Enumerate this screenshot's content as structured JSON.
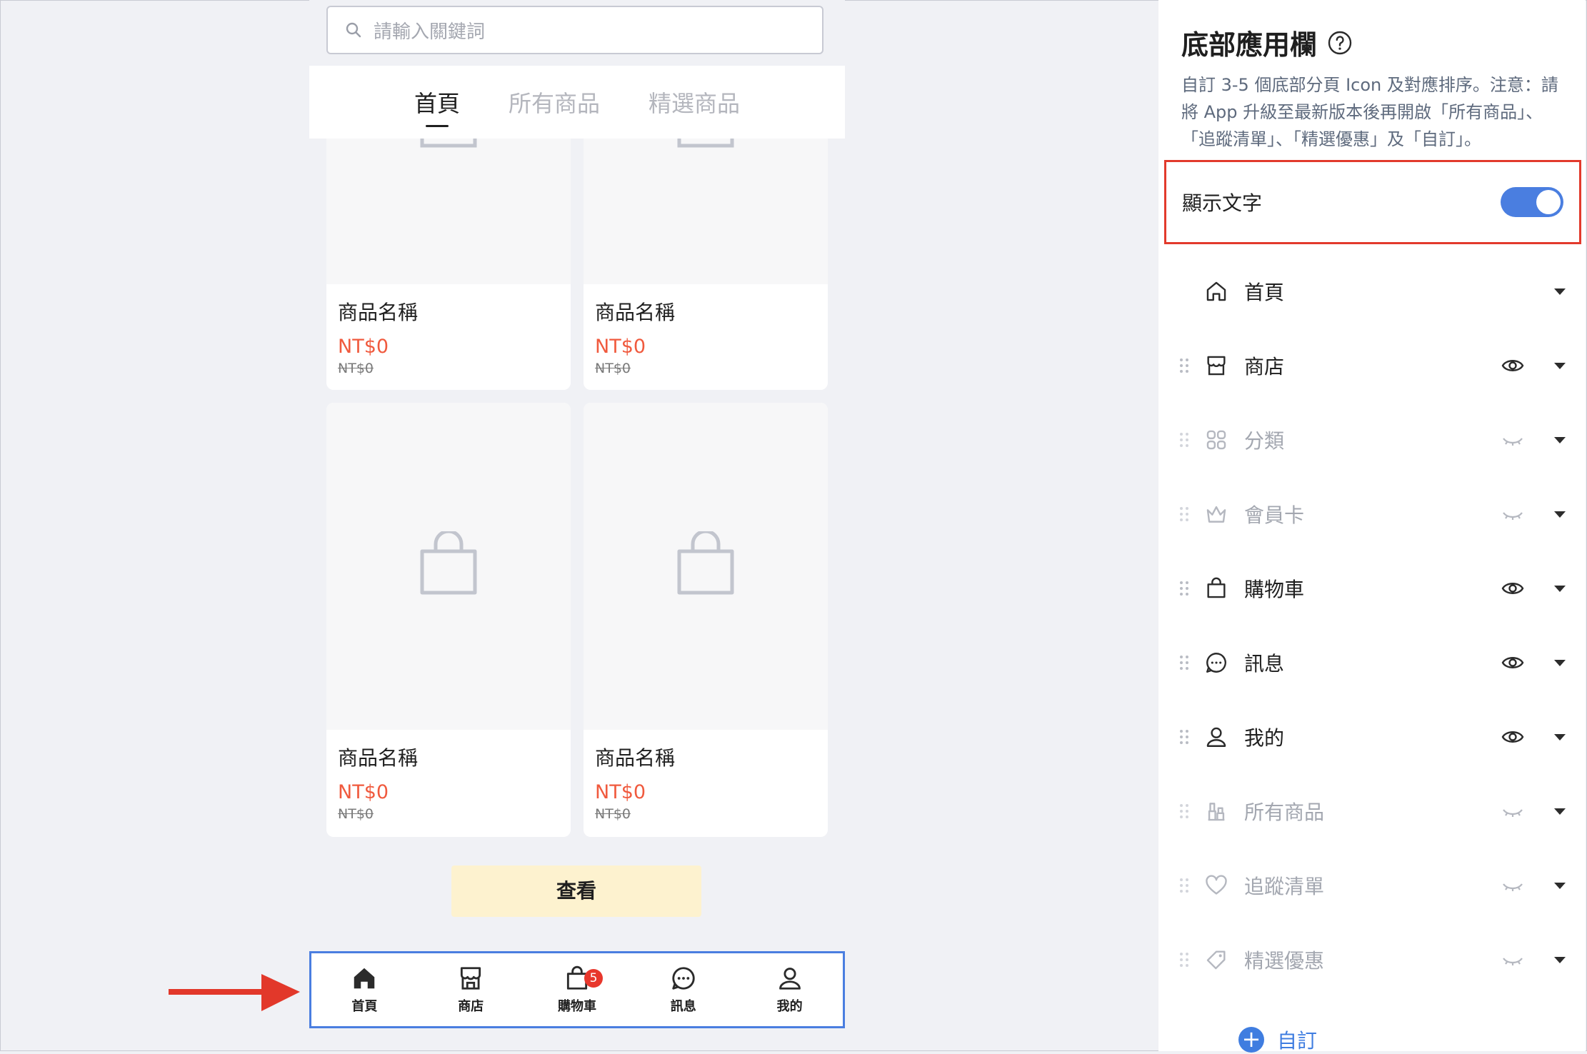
{
  "phone": {
    "search_placeholder": "請輸入關鍵詞",
    "tabs": [
      {
        "label": "首頁",
        "active": true
      },
      {
        "label": "所有商品",
        "active": false
      },
      {
        "label": "精選商品",
        "active": false
      }
    ],
    "products": [
      {
        "name": "商品名稱",
        "price": "NT$0",
        "original_price": "NT$0"
      },
      {
        "name": "商品名稱",
        "price": "NT$0",
        "original_price": "NT$0"
      },
      {
        "name": "商品名稱",
        "price": "NT$0",
        "original_price": "NT$0"
      },
      {
        "name": "商品名稱",
        "price": "NT$0",
        "original_price": "NT$0"
      }
    ],
    "view_button": "查看",
    "bottom_nav": [
      {
        "label": "首頁",
        "icon": "home-icon"
      },
      {
        "label": "商店",
        "icon": "store-icon"
      },
      {
        "label": "購物車",
        "icon": "cart-bag-icon",
        "badge": "5"
      },
      {
        "label": "訊息",
        "icon": "chat-icon"
      },
      {
        "label": "我的",
        "icon": "user-icon"
      }
    ]
  },
  "panel": {
    "title": "底部應用欄",
    "description": "自訂 3-5 個底部分頁 Icon 及對應排序。注意：請將 App 升級至最新版本後再開啟「所有商品」、「追蹤清單」、「精選優惠」及「自訂」。",
    "show_text_label": "顯示文字",
    "show_text_enabled": true,
    "items": [
      {
        "label": "首頁",
        "icon": "home-icon",
        "visible": true,
        "fixed": true
      },
      {
        "label": "商店",
        "icon": "store-icon",
        "visible": true
      },
      {
        "label": "分類",
        "icon": "category-icon",
        "visible": false
      },
      {
        "label": "會員卡",
        "icon": "crown-icon",
        "visible": false
      },
      {
        "label": "購物車",
        "icon": "bag-icon",
        "visible": true
      },
      {
        "label": "訊息",
        "icon": "chat-icon",
        "visible": true
      },
      {
        "label": "我的",
        "icon": "user-icon",
        "visible": true
      },
      {
        "label": "所有商品",
        "icon": "all-products-icon",
        "visible": false
      },
      {
        "label": "追蹤清單",
        "icon": "heart-icon",
        "visible": false
      },
      {
        "label": "精選優惠",
        "icon": "tag-icon",
        "visible": false
      }
    ],
    "custom_button": "自訂"
  },
  "colors": {
    "accent": "#4a7ee0",
    "price": "#f05a3e",
    "highlight": "#e23a2c"
  }
}
